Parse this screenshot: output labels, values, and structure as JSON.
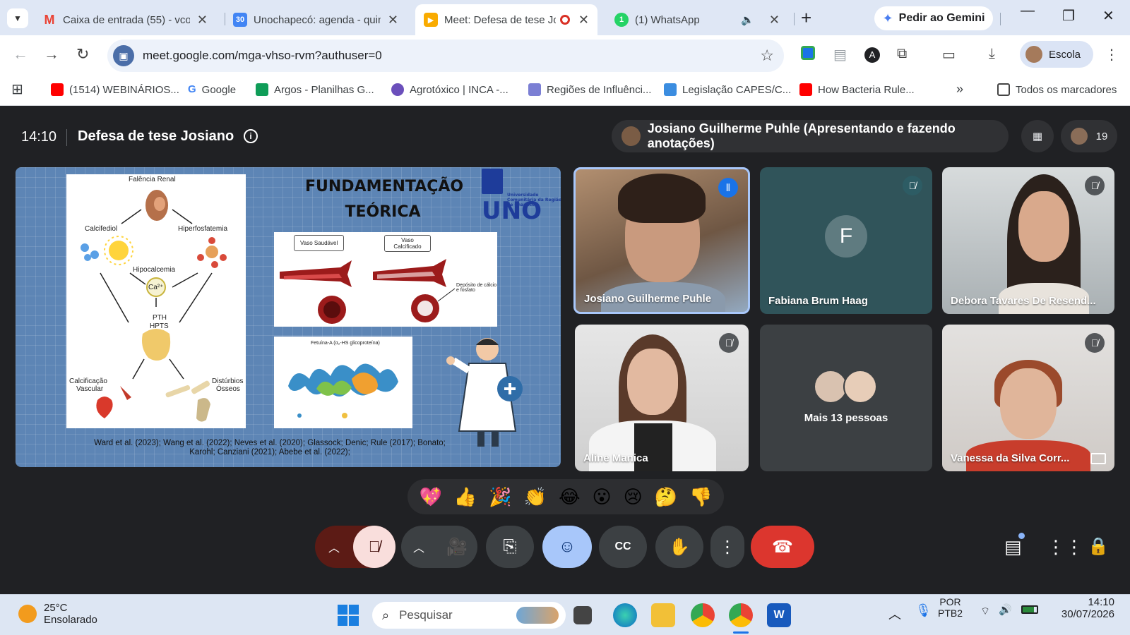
{
  "browser": {
    "tabs": [
      {
        "title": "Caixa de entrada (55) - vcol",
        "icon": "gmail-icon",
        "color": "#ea4335"
      },
      {
        "title": "Unochapecó: agenda - quin",
        "icon": "calendar-icon",
        "color": "#4285f4"
      },
      {
        "title": "Meet: Defesa de tese Jo",
        "icon": "meet-icon",
        "color": "#f9ab00"
      },
      {
        "title": "(1) WhatsApp",
        "icon": "whatsapp-icon",
        "color": "#25d366"
      }
    ],
    "calendar_icon_text": "30",
    "whatsapp_icon_text": "1",
    "gemini_label": "Pedir ao Gemini",
    "url": "meet.google.com/mga-vhso-rvm?authuser=0",
    "profile_label": "Escola",
    "bookmarks": [
      {
        "label": "(1514) WEBINÁRIOS...",
        "color": "#ff0000"
      },
      {
        "label": "Google",
        "color": "#4285f4"
      },
      {
        "label": "Argos - Planilhas G...",
        "color": "#0f9d58"
      },
      {
        "label": "Agrotóxico | INCA -...",
        "color": "#6b4fbb"
      },
      {
        "label": "Regiões de Influênci...",
        "color": "#7b7fd4"
      },
      {
        "label": "Legislação CAPES/C...",
        "color": "#3b8de0"
      },
      {
        "label": "How Bacteria Rule...",
        "color": "#ff0000"
      }
    ],
    "all_bookmarks_label": "Todos os marcadores"
  },
  "meet": {
    "time": "14:10",
    "title": "Defesa de tese Josiano",
    "presenter": "Josiano Guilherme Puhle (Apresentando e fazendo anotações)",
    "participant_count": "19",
    "slide": {
      "title_line1": "FUNDAMENTAÇÃO",
      "title_line2": "TEÓRICA",
      "logo": "UNO",
      "logo_sub": "Universidade Comunitária da Região de Chapecó",
      "diagram_labels": {
        "renal": "Falência Renal",
        "calcifediol": "Calcifediol",
        "hiperfos": "Hiperfosfatemia",
        "hipocalcemia": "Hipocalcemia",
        "ca": "Ca²⁺",
        "pth": "PTH",
        "hpts": "HPTS",
        "calcificacao": "Calcificação",
        "vascular": "Vascular",
        "disturbios": "Distúrbios",
        "osseos": "Ósseos",
        "vaso_saudavel": "Vaso Saudável",
        "vaso_calcificado": "Vaso Calcificado",
        "deposito": "Depósito de cálcio e fosfato",
        "fetuina": "Fetuína-A (α₂-HS glicoproteína)"
      },
      "references_line1": "Ward et al. (2023); Wang et al. (2022); Neves et al. (2020); Glassock; Denic; Rule (2017); Bonato;",
      "references_line2": "Karohl; Canziani (2021); Abebe et al. (2022);"
    },
    "tiles": [
      {
        "name": "Josiano Guilherme Puhle",
        "initial": "",
        "speaking": true
      },
      {
        "name": "Fabiana Brum Haag",
        "initial": "F",
        "muted": true
      },
      {
        "name": "Debora Tavares De Resend...",
        "muted": true
      },
      {
        "name": "Aline Manica",
        "muted": true
      },
      {
        "name": "Mais 13 pessoas"
      },
      {
        "name": "Vanessa da Silva Corr...",
        "muted": true
      }
    ],
    "reactions": [
      "💖",
      "👍",
      "🎉",
      "👏",
      "😂",
      "😮",
      "😢",
      "🤔",
      "👎"
    ]
  },
  "taskbar": {
    "temperature": "25°C",
    "weather": "Ensolarado",
    "search_placeholder": "Pesquisar",
    "lang1": "POR",
    "lang2": "PTB2",
    "time": "14:10",
    "date": "30/07/2026"
  }
}
